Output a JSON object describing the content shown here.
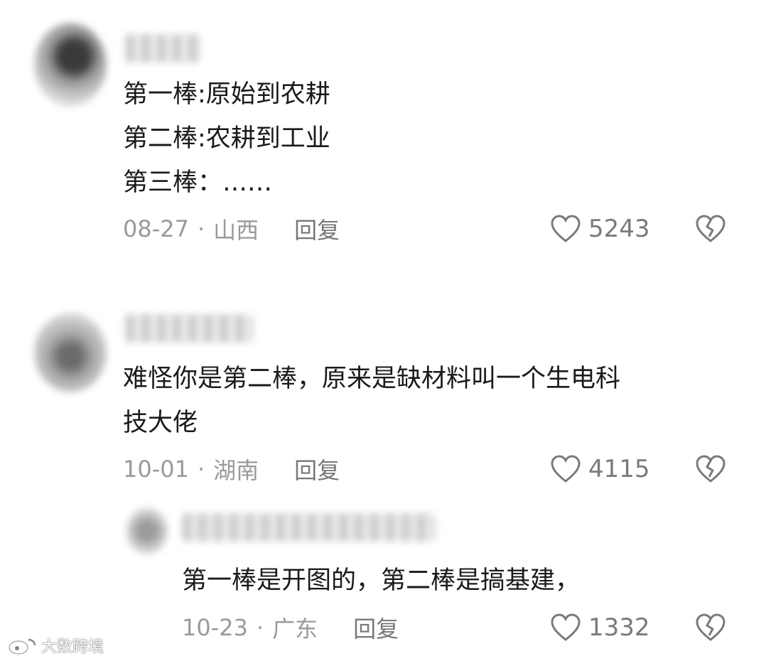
{
  "comments": [
    {
      "text": "第一棒:原始到农耕\n第二棒:农耕到工业\n第三棒：……",
      "date": "08-27",
      "separator": "·",
      "location": "山西",
      "reply_label": "回复",
      "likes": "5243"
    },
    {
      "text": "难怪你是第二棒，原来是缺材料叫一个生电科\n技大佬",
      "date": "10-01",
      "separator": "·",
      "location": "湖南",
      "reply_label": "回复",
      "likes": "4115"
    },
    {
      "text": "第一棒是开图的，第二棒是搞基建，",
      "date": "10-23",
      "separator": "·",
      "location": "广东",
      "reply_label": "回复",
      "likes": "1332"
    }
  ],
  "watermark": "大数跨境",
  "icons": {
    "like": "heart-outline-icon",
    "dislike": "broken-heart-icon",
    "watermark": "weibo-logo-icon"
  },
  "colors": {
    "text": "#1a1a1a",
    "meta": "#9a9a9a",
    "icon": "#7a7a7a"
  }
}
